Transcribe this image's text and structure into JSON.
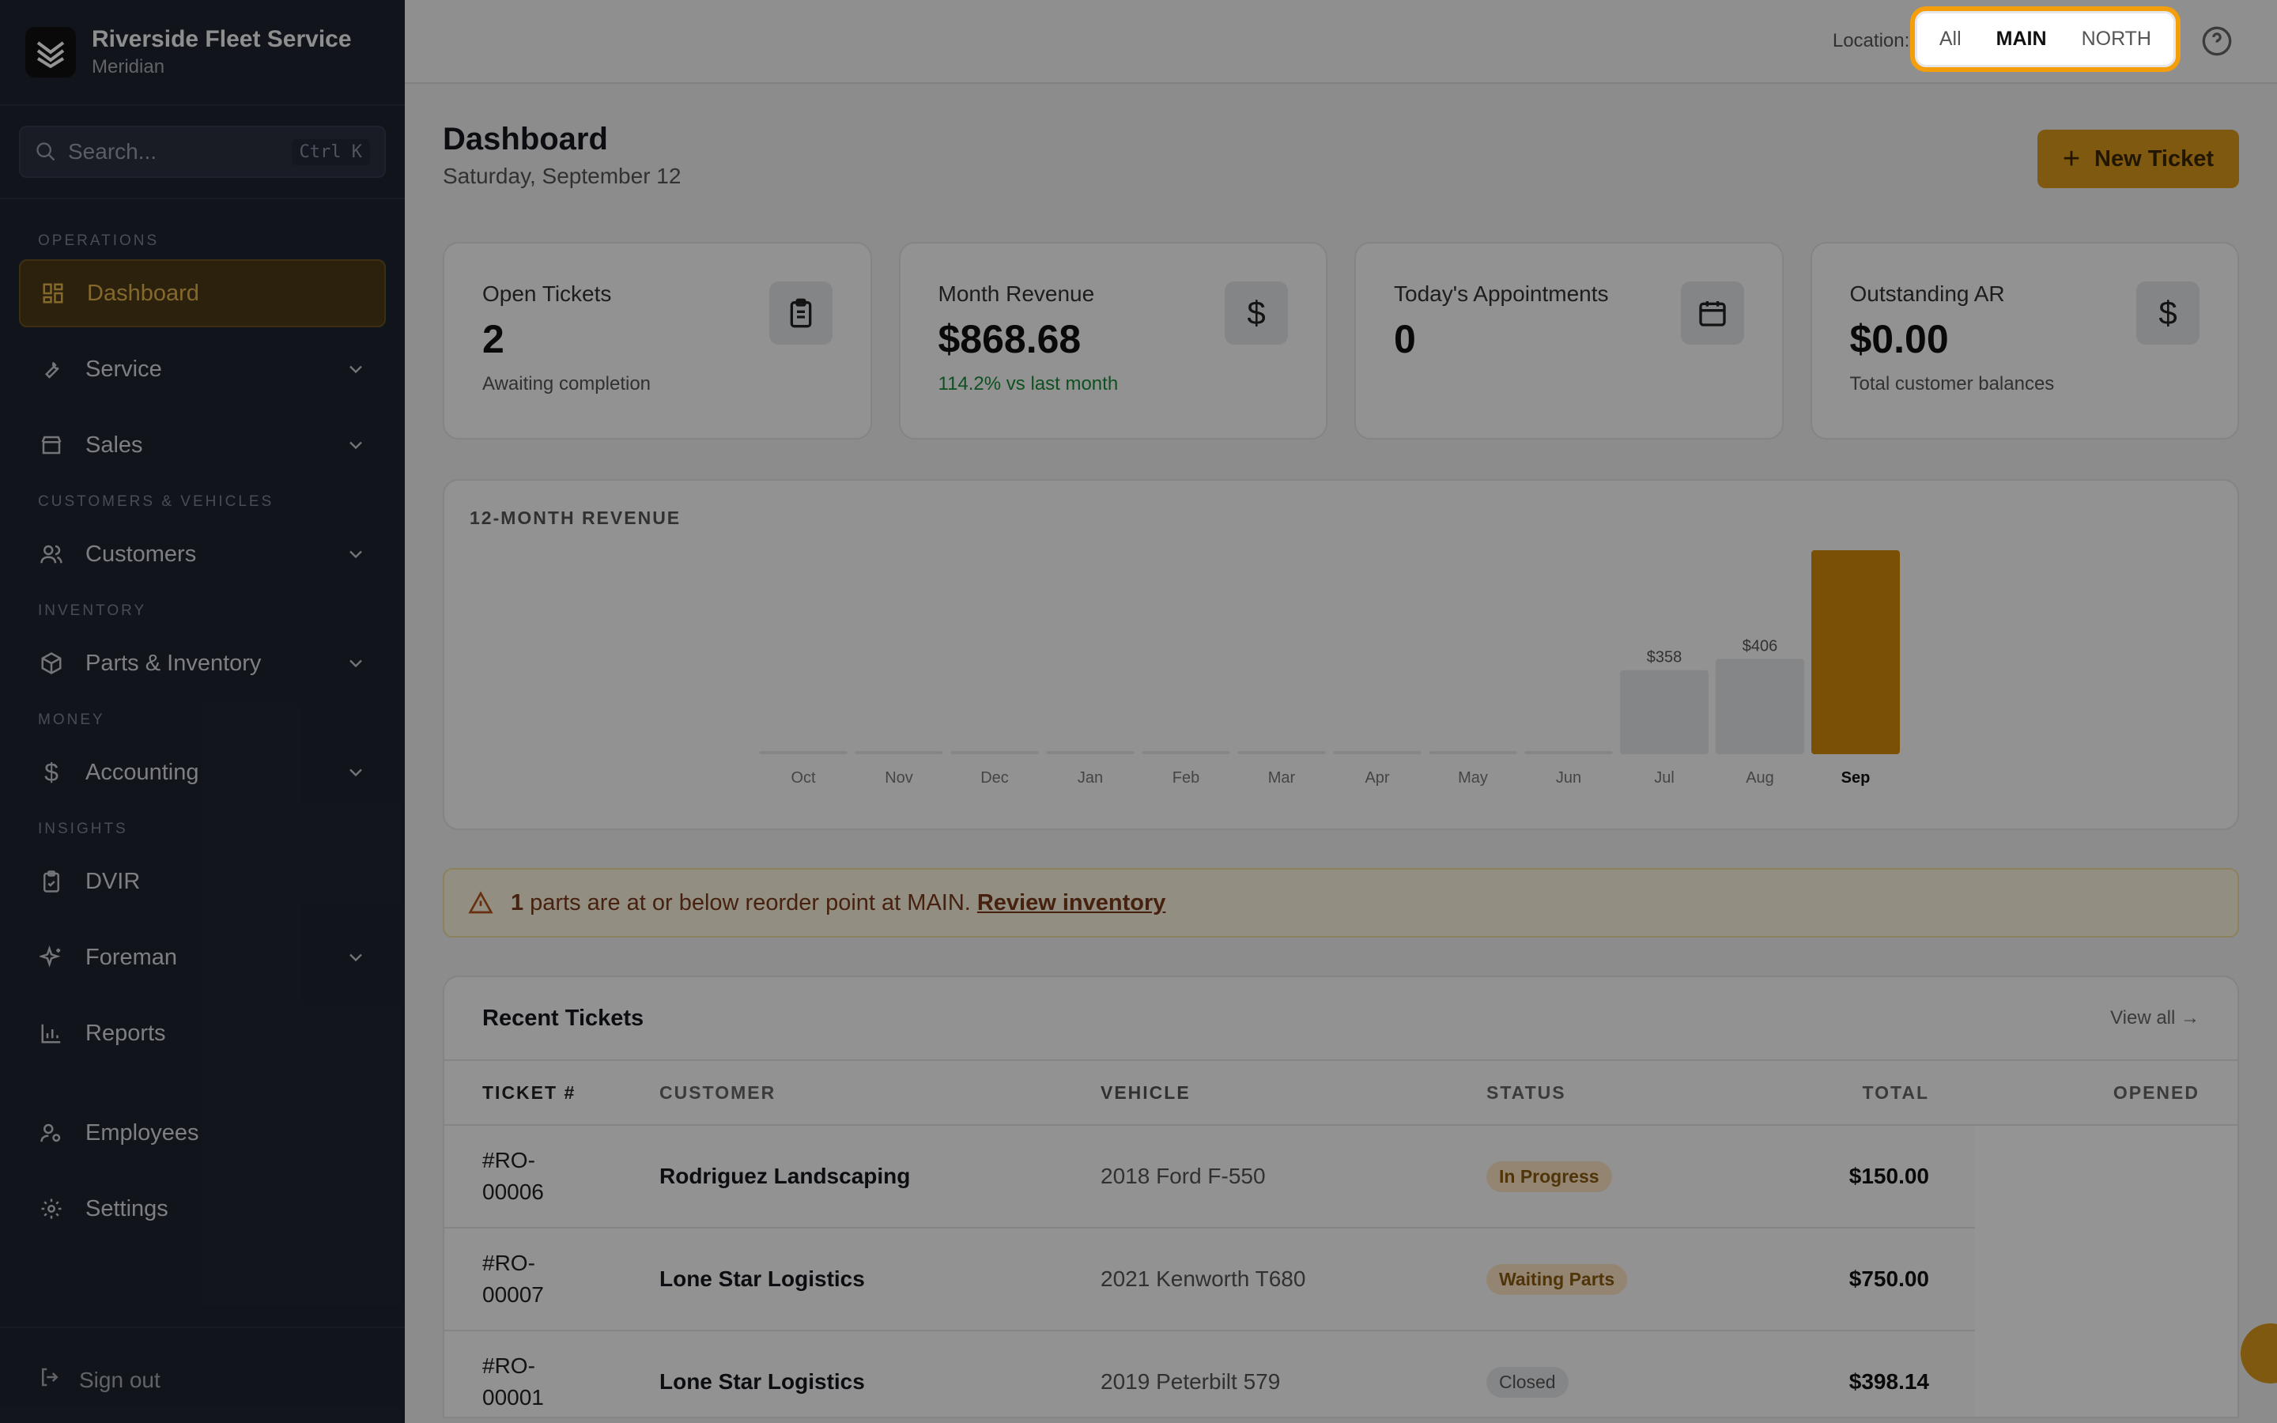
{
  "brand": {
    "name": "Riverside Fleet Service",
    "subtitle": "Meridian"
  },
  "search": {
    "placeholder": "Search...",
    "shortcut": "Ctrl K"
  },
  "nav": {
    "sections": {
      "operations": "OPERATIONS",
      "customers_vehicles": "CUSTOMERS & VEHICLES",
      "inventory": "INVENTORY",
      "money": "MONEY",
      "insights": "INSIGHTS"
    },
    "items": {
      "dashboard": "Dashboard",
      "service": "Service",
      "sales": "Sales",
      "customers": "Customers",
      "parts": "Parts & Inventory",
      "accounting": "Accounting",
      "dvir": "DVIR",
      "foreman": "Foreman",
      "reports": "Reports",
      "employees": "Employees",
      "settings": "Settings"
    },
    "signout": "Sign out"
  },
  "topbar": {
    "location_label": "Location:",
    "location_options": [
      "All",
      "MAIN",
      "NORTH"
    ],
    "selected_location": "MAIN"
  },
  "page": {
    "title": "Dashboard",
    "date": "Saturday, September 12",
    "new_ticket": "New Ticket"
  },
  "stats": [
    {
      "title": "Open Tickets",
      "value": "2",
      "sub": "Awaiting completion",
      "icon": "clipboard-icon"
    },
    {
      "title": "Month Revenue",
      "value": "$868.68",
      "sub": "114.2% vs last month",
      "icon": "dollar-icon"
    },
    {
      "title": "Today's Appointments",
      "value": "0",
      "sub": "",
      "icon": "calendar-icon"
    },
    {
      "title": "Outstanding AR",
      "value": "$0.00",
      "sub": "Total customer balances",
      "icon": "dollar-icon"
    }
  ],
  "chart_title": "12-MONTH REVENUE",
  "chart_data": {
    "type": "bar",
    "title": "12-MONTH REVENUE",
    "categories": [
      "Oct",
      "Nov",
      "Dec",
      "Jan",
      "Feb",
      "Mar",
      "Apr",
      "May",
      "Jun",
      "Jul",
      "Aug",
      "Sep"
    ],
    "values": [
      0,
      0,
      0,
      0,
      0,
      0,
      0,
      0,
      0,
      358,
      406,
      869
    ],
    "data_labels": [
      "",
      "",
      "",
      "",
      "",
      "",
      "",
      "",
      "",
      "$358",
      "$406",
      ""
    ],
    "highlight_index": 11,
    "colors": {
      "bar": "#e5e7eb",
      "highlight": "#d18a0a"
    }
  },
  "alert": {
    "count": "1",
    "text": "parts are at or below reorder point at MAIN.",
    "link": "Review inventory"
  },
  "tickets": {
    "title": "Recent Tickets",
    "view_all": "View all →",
    "columns": [
      "TICKET #",
      "CUSTOMER",
      "VEHICLE",
      "STATUS",
      "TOTAL",
      "OPENED"
    ],
    "rows": [
      {
        "ticket_a": "#RO-",
        "ticket_b": "00006",
        "customer": "Rodriguez Landscaping",
        "vehicle": "2018 Ford F-550",
        "status": "In Progress",
        "total": "$150.00"
      },
      {
        "ticket_a": "#RO-",
        "ticket_b": "00007",
        "customer": "Lone Star Logistics",
        "vehicle": "2021 Kenworth T680",
        "status": "Waiting Parts",
        "total": "$750.00"
      },
      {
        "ticket_a": "#RO-",
        "ticket_b": "00001",
        "customer": "Lone Star Logistics",
        "vehicle": "2019 Peterbilt 579",
        "status": "Closed",
        "total": "$398.14"
      }
    ]
  }
}
